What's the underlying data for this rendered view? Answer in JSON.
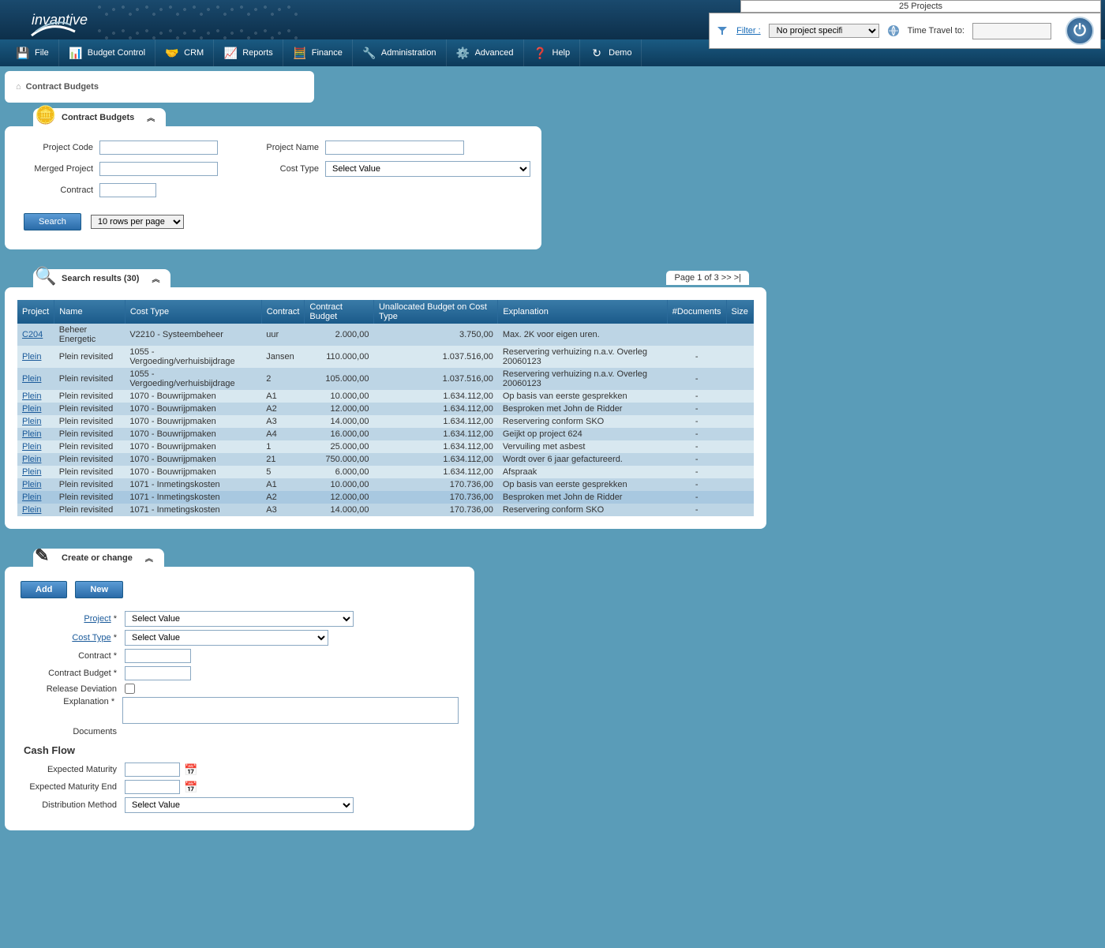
{
  "header": {
    "logo": "invantive",
    "project_count": "25 Projects",
    "filter_label": "Filter :",
    "filter_value": "No project specific filter",
    "time_travel_label": "Time Travel to:"
  },
  "menu": [
    {
      "label": "File",
      "icon": "💾"
    },
    {
      "label": "Budget Control",
      "icon": "📊"
    },
    {
      "label": "CRM",
      "icon": "🤝"
    },
    {
      "label": "Reports",
      "icon": "📈"
    },
    {
      "label": "Finance",
      "icon": "🧮"
    },
    {
      "label": "Administration",
      "icon": "🔧"
    },
    {
      "label": "Advanced",
      "icon": "⚙️"
    },
    {
      "label": "Help",
      "icon": "❓"
    },
    {
      "label": "Demo",
      "icon": "↻"
    }
  ],
  "breadcrumb": "Contract Budgets",
  "search_panel": {
    "title": "Contract Budgets",
    "labels": {
      "project_code": "Project Code",
      "project_name": "Project Name",
      "merged_project": "Merged Project",
      "cost_type": "Cost Type",
      "contract": "Contract"
    },
    "cost_type_value": "Select Value",
    "search_btn": "Search",
    "rows_per_page": "10 rows per page"
  },
  "results": {
    "title": "Search results (30)",
    "pagination": "Page 1 of 3  >>  >|",
    "headers": [
      "Project",
      "Name",
      "Cost Type",
      "Contract",
      "Contract Budget",
      "Unallocated Budget on Cost Type",
      "Explanation",
      "#Documents",
      "Size"
    ],
    "rows": [
      [
        "C204",
        "Beheer Energetic",
        "V2210 - Systeembeheer",
        "uur",
        "2.000,00",
        "3.750,00",
        "Max. 2K voor eigen uren.",
        "",
        ""
      ],
      [
        "Plein",
        "Plein revisited",
        "1055 - Vergoeding/verhuisbijdrage",
        "Jansen",
        "110.000,00",
        "1.037.516,00",
        "Reservering verhuizing n.a.v. Overleg 20060123",
        "-",
        ""
      ],
      [
        "Plein",
        "Plein revisited",
        "1055 - Vergoeding/verhuisbijdrage",
        "2",
        "105.000,00",
        "1.037.516,00",
        "Reservering verhuizing n.a.v. Overleg 20060123",
        "-",
        ""
      ],
      [
        "Plein",
        "Plein revisited",
        "1070 - Bouwrijpmaken",
        "A1",
        "10.000,00",
        "1.634.112,00",
        "Op basis van eerste gesprekken",
        "-",
        ""
      ],
      [
        "Plein",
        "Plein revisited",
        "1070 - Bouwrijpmaken",
        "A2",
        "12.000,00",
        "1.634.112,00",
        "Besproken met John de Ridder",
        "-",
        ""
      ],
      [
        "Plein",
        "Plein revisited",
        "1070 - Bouwrijpmaken",
        "A3",
        "14.000,00",
        "1.634.112,00",
        "Reservering conform SKO",
        "-",
        ""
      ],
      [
        "Plein",
        "Plein revisited",
        "1070 - Bouwrijpmaken",
        "A4",
        "16.000,00",
        "1.634.112,00",
        "Geijkt op project 624",
        "-",
        ""
      ],
      [
        "Plein",
        "Plein revisited",
        "1070 - Bouwrijpmaken",
        "1",
        "25.000,00",
        "1.634.112,00",
        "Vervuiling met asbest",
        "-",
        ""
      ],
      [
        "Plein",
        "Plein revisited",
        "1070 - Bouwrijpmaken",
        "21",
        "750.000,00",
        "1.634.112,00",
        "Wordt over 6 jaar gefactureerd.",
        "-",
        ""
      ],
      [
        "Plein",
        "Plein revisited",
        "1070 - Bouwrijpmaken",
        "5",
        "6.000,00",
        "1.634.112,00",
        "Afspraak",
        "-",
        ""
      ],
      [
        "Plein",
        "Plein revisited",
        "1071 - Inmetingskosten",
        "A1",
        "10.000,00",
        "170.736,00",
        "Op basis van eerste gesprekken",
        "-",
        ""
      ],
      [
        "Plein",
        "Plein revisited",
        "1071 - Inmetingskosten",
        "A2",
        "12.000,00",
        "170.736,00",
        "Besproken met John de Ridder",
        "-",
        ""
      ],
      [
        "Plein",
        "Plein revisited",
        "1071 - Inmetingskosten",
        "A3",
        "14.000,00",
        "170.736,00",
        "Reservering conform SKO",
        "-",
        ""
      ]
    ]
  },
  "form": {
    "title": "Create or change",
    "add_btn": "Add",
    "new_btn": "New",
    "labels": {
      "project": "Project",
      "cost_type": "Cost Type",
      "contract": "Contract",
      "contract_budget": "Contract Budget",
      "release_deviation": "Release Deviation",
      "explanation": "Explanation",
      "documents": "Documents",
      "cash_flow": "Cash Flow",
      "expected_maturity": "Expected Maturity",
      "expected_maturity_end": "Expected Maturity End",
      "distribution_method": "Distribution Method"
    },
    "select_value": "Select Value"
  }
}
